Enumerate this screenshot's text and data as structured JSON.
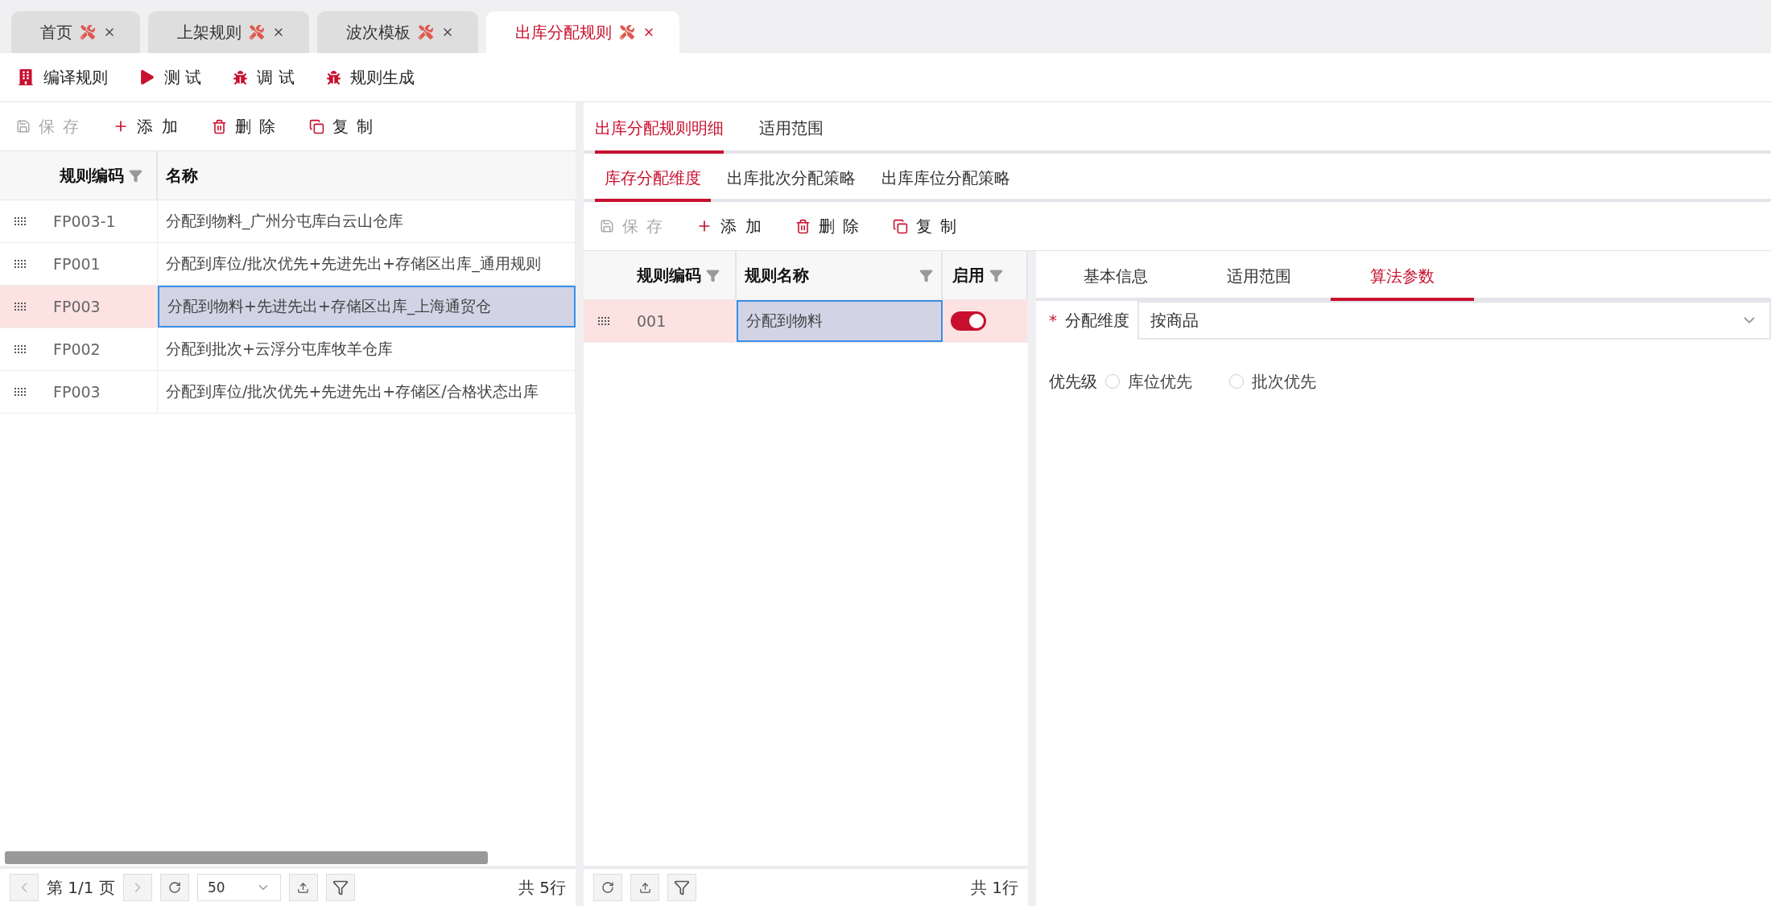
{
  "tabs": [
    {
      "label": "首页",
      "selected": false
    },
    {
      "label": "上架规则",
      "selected": false
    },
    {
      "label": "波次模板",
      "selected": false
    },
    {
      "label": "出库分配规则",
      "selected": true
    }
  ],
  "toolbar": [
    {
      "label": "编译规则",
      "kind": "building"
    },
    {
      "label": "测 试",
      "kind": "play"
    },
    {
      "label": "调 试",
      "kind": "bug"
    },
    {
      "label": "规则生成",
      "kind": "bug"
    }
  ],
  "rule_list": {
    "toolbar": [
      {
        "label": "保 存",
        "kind": "save",
        "disabled": true
      },
      {
        "label": "添 加",
        "kind": "add",
        "disabled": false
      },
      {
        "label": "删 除",
        "kind": "delete",
        "disabled": false
      },
      {
        "label": "复 制",
        "kind": "copy",
        "disabled": false
      }
    ],
    "columns": [
      "规则编码",
      "名称"
    ],
    "rows": [
      {
        "code": "FP003-1",
        "name": "分配到物料_广州分屯库白云山仓库",
        "selected": false
      },
      {
        "code": "FP001",
        "name": "分配到库位/批次优先+先进先出+存储区出库_通用规则",
        "selected": false
      },
      {
        "code": "FP003",
        "name": "分配到物料+先进先出+存储区出库_上海通贸仓",
        "selected": true
      },
      {
        "code": "FP002",
        "name": "分配到批次+云浮分屯库牧羊仓库",
        "selected": false
      },
      {
        "code": "FP003",
        "name": "分配到库位/批次优先+先进先出+存储区/合格状态出库",
        "selected": false
      }
    ],
    "pager": {
      "page": "第 1/1 页",
      "page_size": "50",
      "total": "共 5行"
    }
  },
  "detail_tabs": [
    {
      "label": "出库分配规则明细",
      "selected": true
    },
    {
      "label": "适用范围",
      "selected": false
    }
  ],
  "sub_tabs": [
    {
      "label": "库存分配维度",
      "selected": true
    },
    {
      "label": "出库批次分配策略",
      "selected": false
    },
    {
      "label": "出库库位分配策略",
      "selected": false
    }
  ],
  "detail_toolbar": [
    {
      "label": "保 存",
      "kind": "save",
      "disabled": true
    },
    {
      "label": "添 加",
      "kind": "add",
      "disabled": false
    },
    {
      "label": "删 除",
      "kind": "delete",
      "disabled": false
    },
    {
      "label": "复 制",
      "kind": "copy",
      "disabled": false
    }
  ],
  "detail_table": {
    "columns": [
      "规则编码",
      "规则名称",
      "启用"
    ],
    "rows": [
      {
        "code": "001",
        "name": "分配到物料",
        "enabled": true,
        "selected": true
      }
    ],
    "total": "共 1行"
  },
  "param_tabs": [
    {
      "label": "基本信息",
      "selected": false
    },
    {
      "label": "适用范围",
      "selected": false
    },
    {
      "label": "算法参数",
      "selected": true
    }
  ],
  "form": {
    "dimension": {
      "label": "分配维度",
      "required_mark": "*",
      "value": "按商品"
    },
    "priority": {
      "label": "优先级",
      "options": [
        {
          "label": "库位优先",
          "selected": false
        },
        {
          "label": "批次优先",
          "selected": false
        }
      ]
    }
  }
}
